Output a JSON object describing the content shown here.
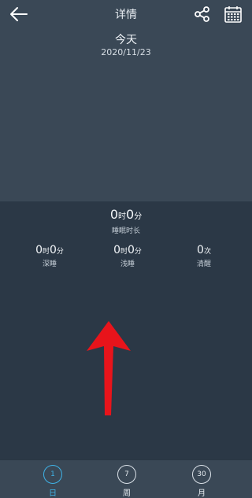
{
  "header": {
    "title": "详情",
    "back_icon": "arrow-left-icon",
    "share_icon": "share-icon",
    "calendar_icon": "calendar-icon"
  },
  "summary": {
    "day_label": "今天",
    "date": "2020/11/23"
  },
  "sleep_total": {
    "hours": "0",
    "hour_unit": "时",
    "minutes": "0",
    "minute_unit": "分",
    "caption": "睡眠时长"
  },
  "stats": [
    {
      "hours": "0",
      "hour_unit": "时",
      "minutes": "0",
      "minute_unit": "分",
      "caption": "深睡"
    },
    {
      "hours": "0",
      "hour_unit": "时",
      "minutes": "0",
      "minute_unit": "分",
      "caption": "浅睡"
    },
    {
      "count": "0",
      "count_unit": "次",
      "caption": "清醒"
    }
  ],
  "tabs": [
    {
      "number": "1",
      "label": "日",
      "active": true
    },
    {
      "number": "7",
      "label": "周",
      "active": false
    },
    {
      "number": "30",
      "label": "月",
      "active": false
    }
  ],
  "colors": {
    "accent": "#3fb2e6",
    "annotation_arrow": "#e8141b"
  }
}
